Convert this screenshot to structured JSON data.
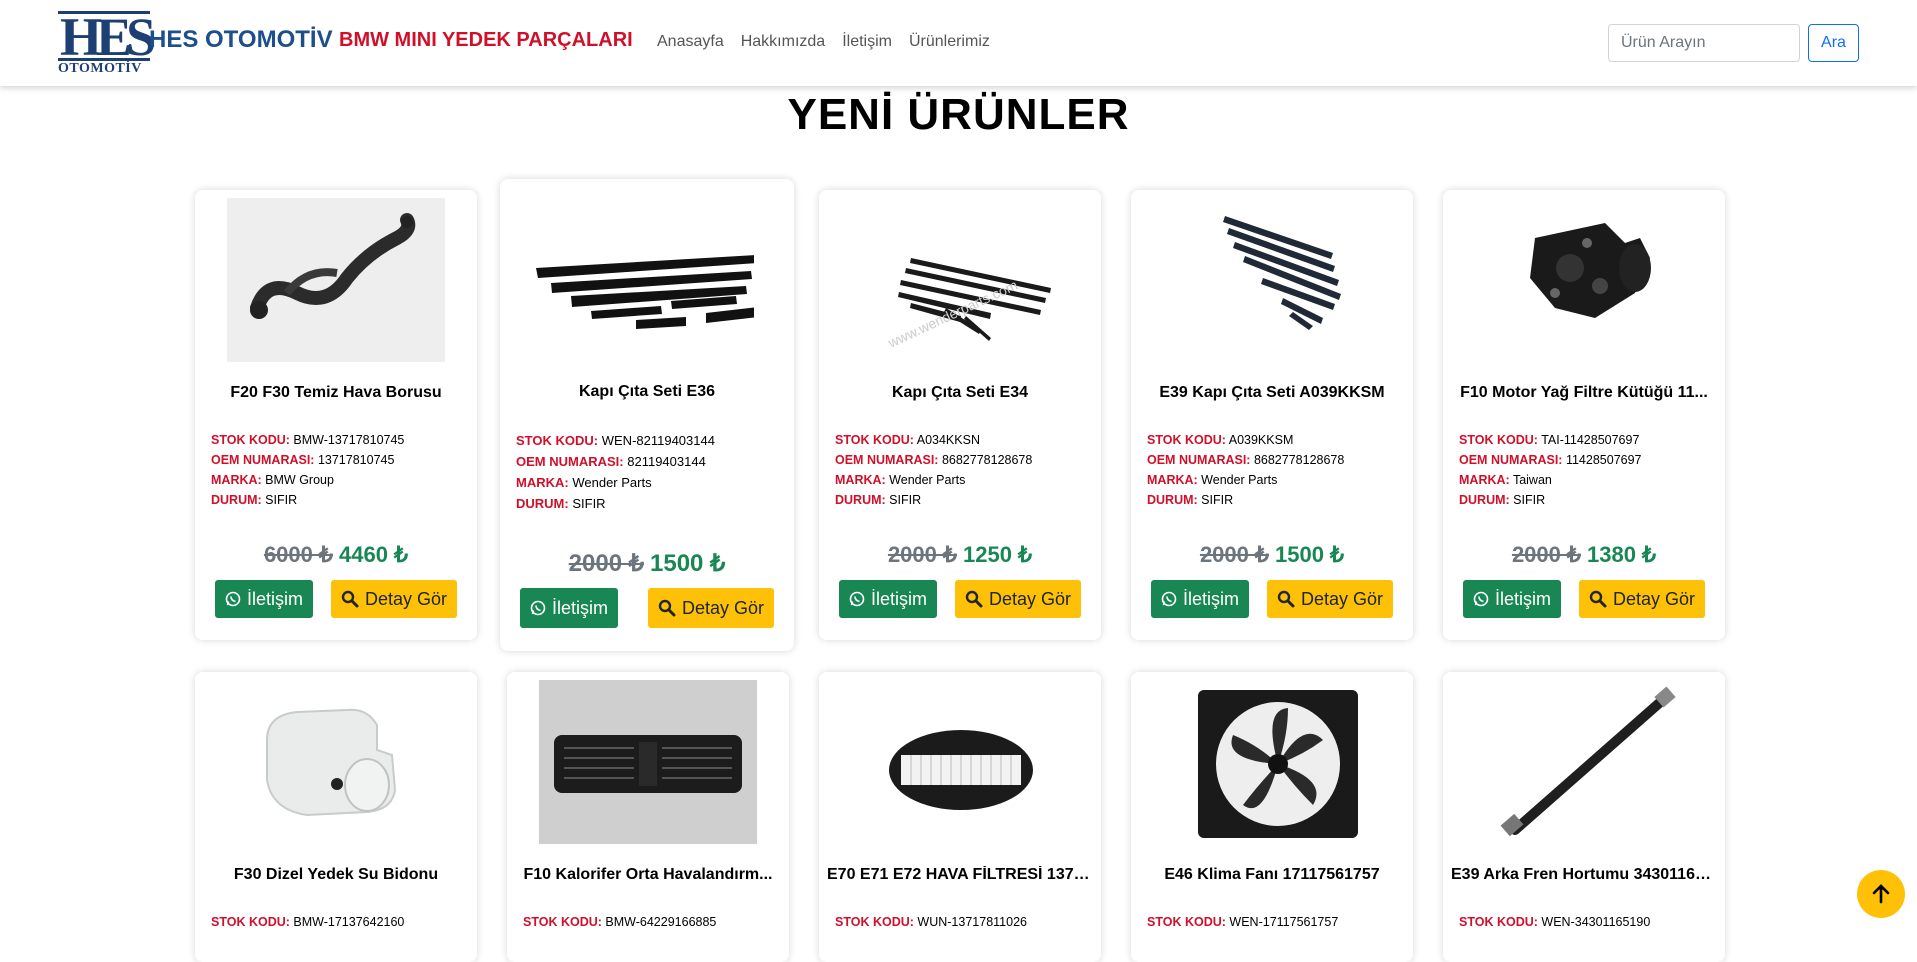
{
  "navbar": {
    "logo_letters": "HES",
    "logo_sub": "OTOMOTİV",
    "brand_main": "HES OTOMOTİV",
    "brand_red": "BMW MINI YEDEK PARÇALARI",
    "links": [
      "Anasayfa",
      "Hakkımızda",
      "İletişim",
      "Ürünlerimiz"
    ],
    "search_placeholder": "Ürün Arayın",
    "search_button": "Ara"
  },
  "section_title": "YENİ ÜRÜNLER",
  "labels": {
    "stok": "STOK KODU:",
    "oem": "OEM NUMARASI:",
    "marka": "MARKA:",
    "durum": "DURUM:",
    "contact_button": "İletişim",
    "detail_button": "Detay Gör"
  },
  "products": [
    {
      "title": "F20 F30 Temiz Hava Borusu",
      "stok": "BMW-13717810745",
      "oem": "13717810745",
      "marka": "BMW Group",
      "durum": "SIFIR",
      "old_price": "6000 ₺",
      "new_price": "4460 ₺",
      "image": "air-pipe"
    },
    {
      "title": "Kapı Çıta Seti E36",
      "stok": "WEN-82119403144",
      "oem": "82119403144",
      "marka": "Wender Parts",
      "durum": "SIFIR",
      "old_price": "2000 ₺",
      "new_price": "1500 ₺",
      "image": "door-trim-set"
    },
    {
      "title": "Kapı Çıta Seti E34",
      "stok": "A034KKSN",
      "oem": "8682778128678",
      "marka": "Wender Parts",
      "durum": "SIFIR",
      "old_price": "2000 ₺",
      "new_price": "1250 ₺",
      "image": "door-trim-set"
    },
    {
      "title": "E39 Kapı Çıta Seti A039KKSM",
      "stok": "A039KKSM",
      "oem": "8682778128678",
      "marka": "Wender Parts",
      "durum": "SIFIR",
      "old_price": "2000 ₺",
      "new_price": "1500 ₺",
      "image": "door-trim-set"
    },
    {
      "title": "F10 Motor Yağ Filtre Kütüğü 11...",
      "stok": "TAI-11428507697",
      "oem": "11428507697",
      "marka": "Taiwan",
      "durum": "SIFIR",
      "old_price": "2000 ₺",
      "new_price": "1380 ₺",
      "image": "oil-filter-housing"
    },
    {
      "title": "F30 Dizel Yedek Su Bidonu",
      "stok": "BMW-17137642160",
      "image": "coolant-tank"
    },
    {
      "title": "F10 Kalorifer Orta Havalandırm...",
      "stok": "BMW-64229166885",
      "image": "air-vent"
    },
    {
      "title": "E70 E71 E72 HAVA FİLTRESİ 1371...",
      "stok": "WUN-13717811026",
      "image": "air-filter"
    },
    {
      "title": "E46 Klima Fanı 17117561757",
      "stok": "WEN-17117561757",
      "image": "radiator-fan"
    },
    {
      "title": "E39 Arka Fren Hortumu 34301165...",
      "stok": "WEN-34301165190",
      "image": "brake-hose"
    }
  ]
}
